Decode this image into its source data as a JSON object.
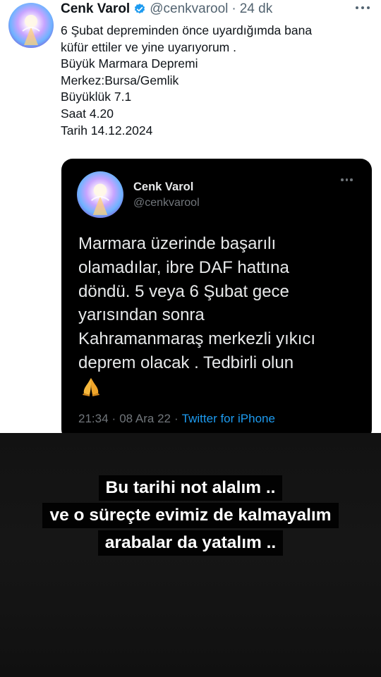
{
  "tweet": {
    "author_name": "Cenk Varol",
    "handle": "@cenkvarool",
    "separator": "·",
    "time": "24 dk",
    "lines": [
      "6 Şubat depreminden önce uyardığımda bana",
      "küfür ettiler ve yine uyarıyorum .",
      "Büyük Marmara Depremi",
      "Merkez:Bursa/Gemlik",
      "Büyüklük 7.1",
      "Saat 4.20",
      "Tarih 14.12.2024"
    ],
    "verified_icon": "verified-badge-icon",
    "accent_color": "#1d9bf0"
  },
  "quoted_tweet": {
    "author_name": "Cenk Varol",
    "handle": "@cenkvarool",
    "lines": [
      "Marmara üzerinde başarılı",
      "olamadılar, ibre DAF hattına",
      "döndü. 5 veya 6 Şubat gece",
      "yarısından sonra",
      "Kahramanmaraş merkezli yıkıcı",
      "deprem olacak . Tedbirli olun"
    ],
    "emoji_icon": "folded-hands-icon",
    "time": "21:34",
    "separator_1": "·",
    "date": "08 Ara 22",
    "separator_2": "·",
    "source": "Twitter for iPhone"
  },
  "story_captions": [
    "Bu tarihi not alalım ..",
    "ve o süreçte evimiz de kalmayalım",
    "arabalar da yatalım .."
  ]
}
